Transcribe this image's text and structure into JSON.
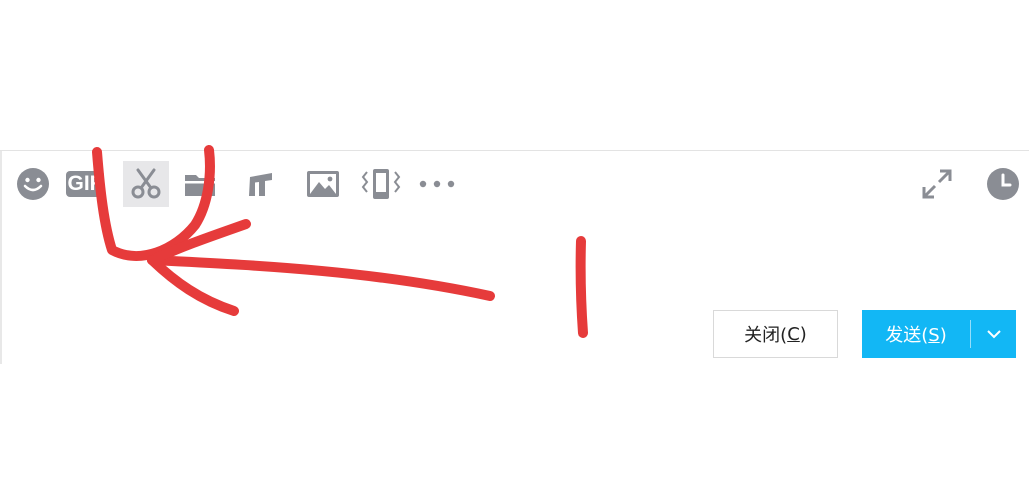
{
  "toolbar": {
    "gif_label": "GIF",
    "icons": [
      "emoji-icon",
      "gif-icon",
      "scissors-icon",
      "folder-icon",
      "text-format-icon",
      "image-icon",
      "shake-window-icon",
      "more-icon",
      "expand-icon",
      "history-clock-icon"
    ]
  },
  "buttons": {
    "close_label": "关闭(",
    "close_key": "C",
    "close_suffix": ")",
    "send_label": "发送(",
    "send_key": "S",
    "send_suffix": ")"
  },
  "colors": {
    "icon_gray": "#8a8d94",
    "send_blue": "#12b7f5",
    "annotation_red": "#e63b3b"
  }
}
